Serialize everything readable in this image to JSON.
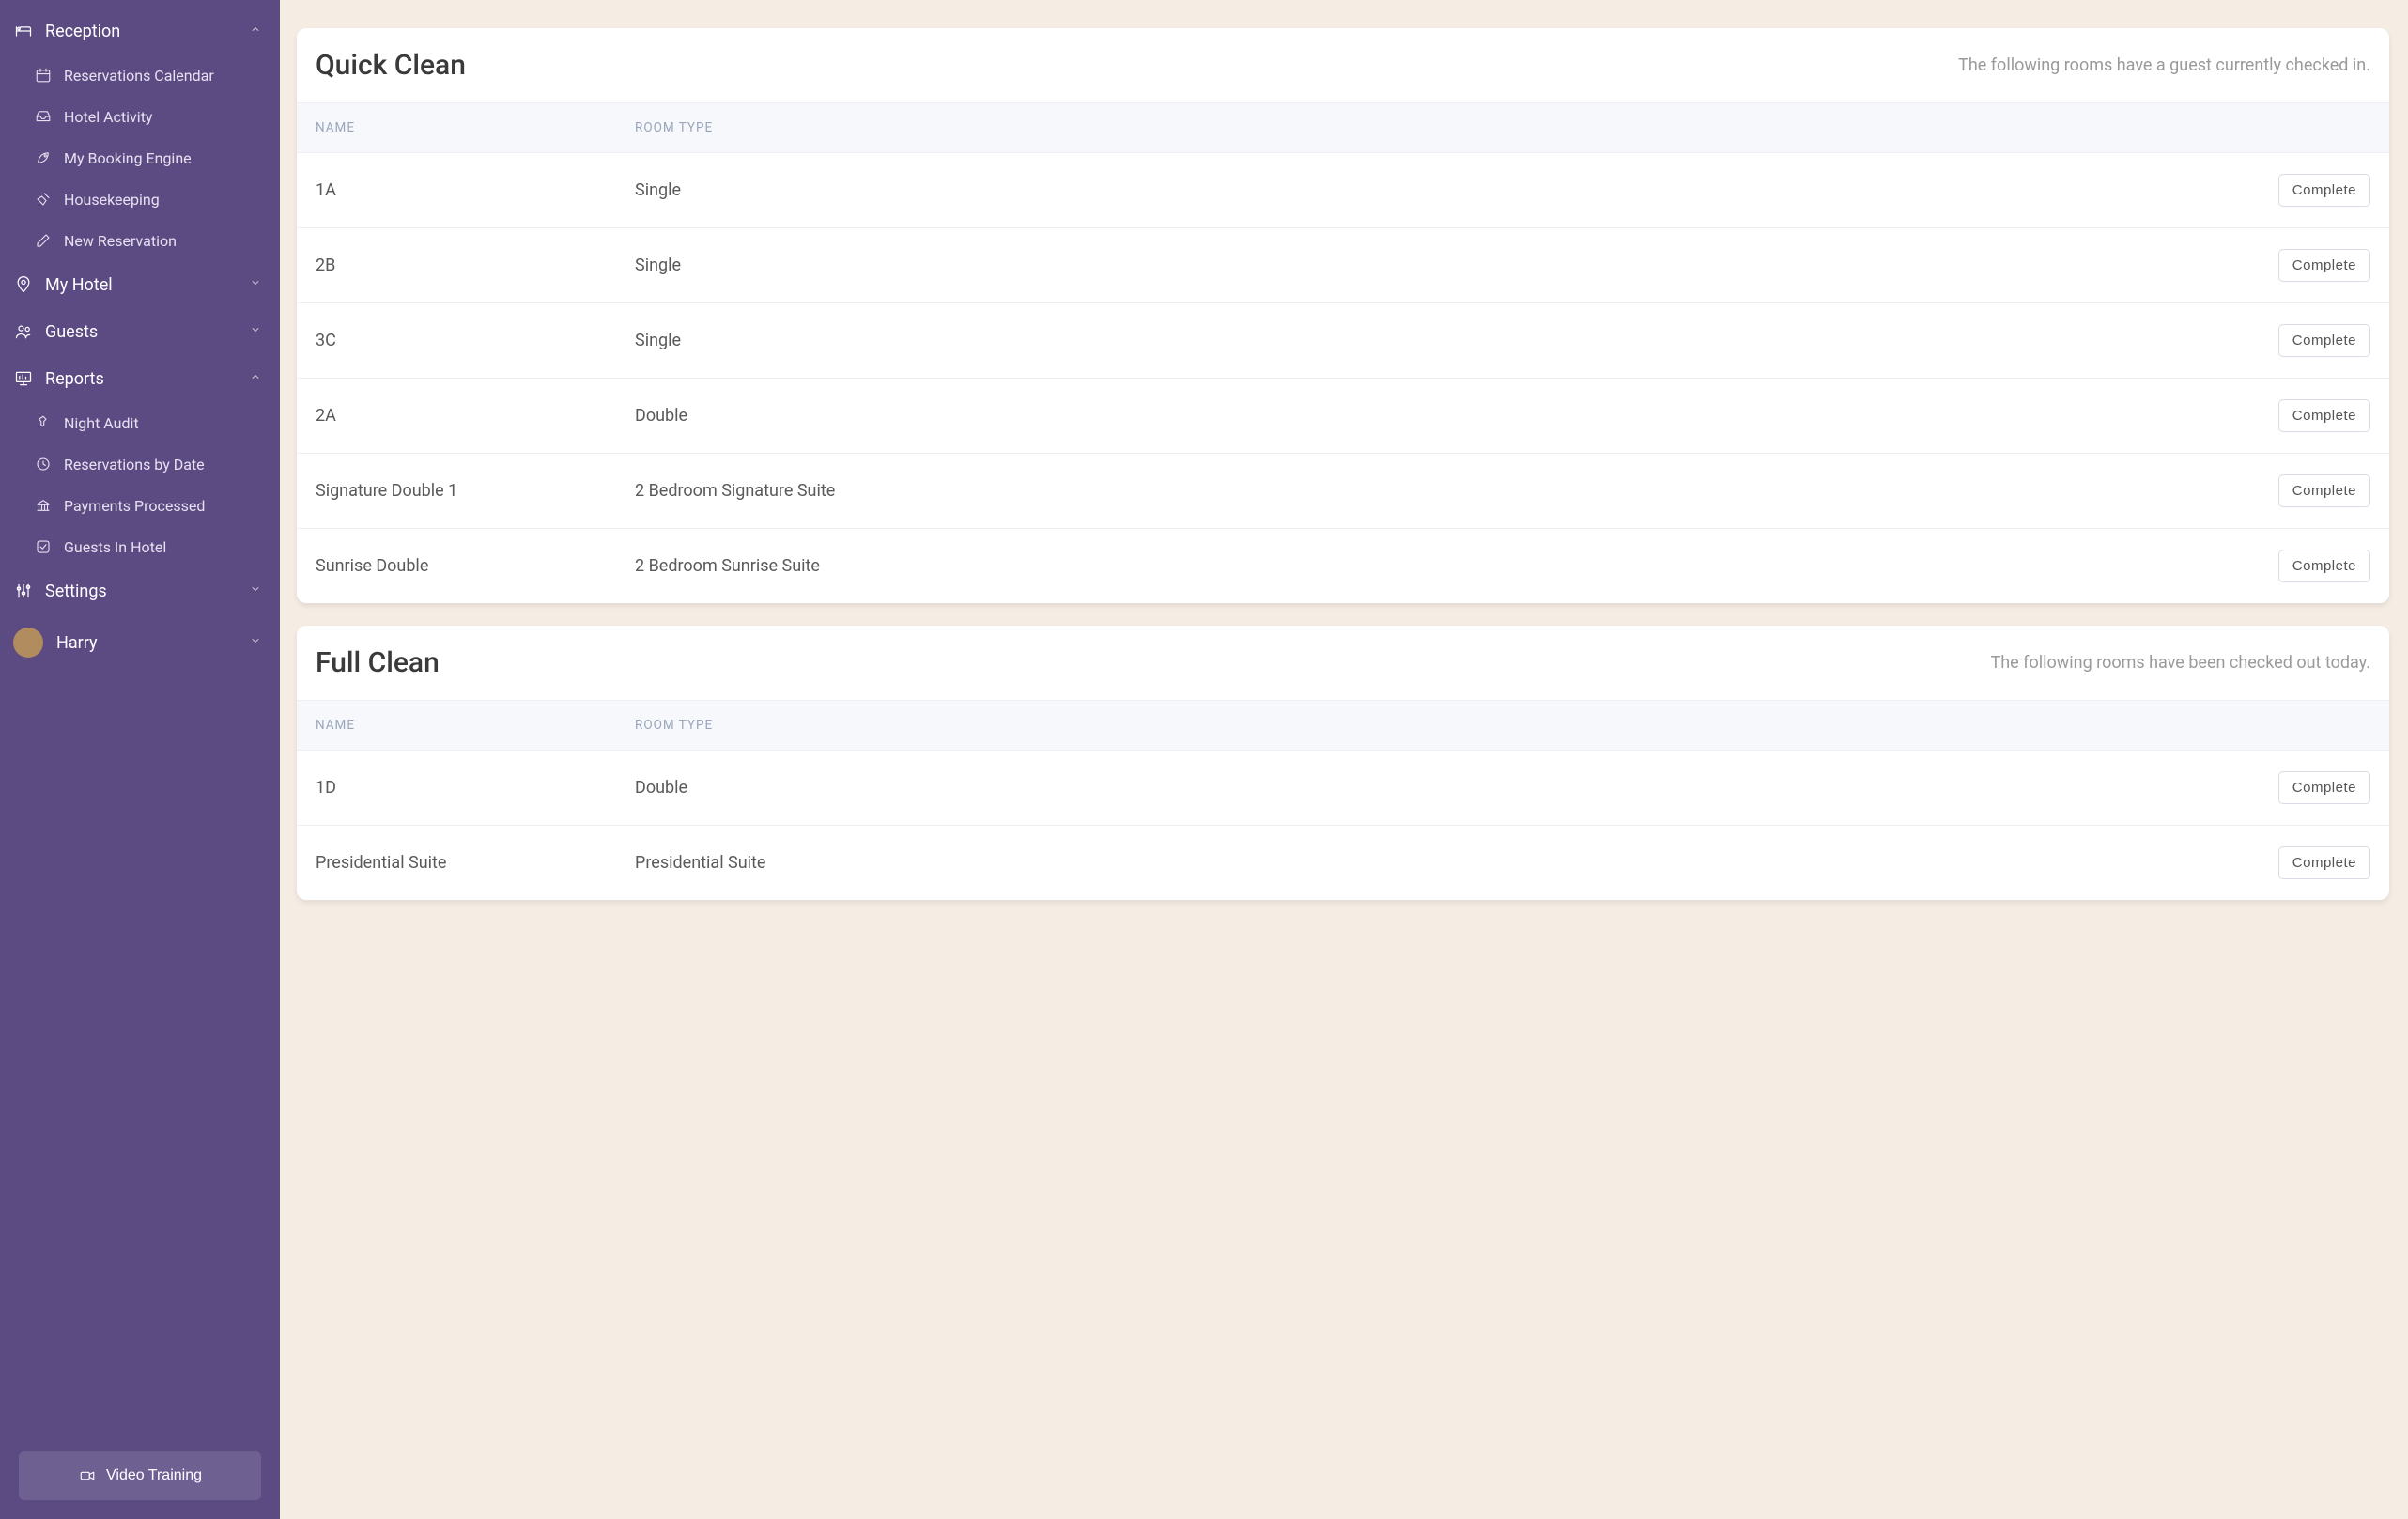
{
  "sidebar": {
    "reception": {
      "label": "Reception",
      "items": [
        {
          "label": "Reservations Calendar"
        },
        {
          "label": "Hotel Activity"
        },
        {
          "label": "My Booking Engine"
        },
        {
          "label": "Housekeeping"
        },
        {
          "label": "New Reservation"
        }
      ]
    },
    "myhotel": {
      "label": "My Hotel"
    },
    "guests": {
      "label": "Guests"
    },
    "reports": {
      "label": "Reports",
      "items": [
        {
          "label": "Night Audit"
        },
        {
          "label": "Reservations by Date"
        },
        {
          "label": "Payments Processed"
        },
        {
          "label": "Guests In Hotel"
        }
      ]
    },
    "settings": {
      "label": "Settings"
    },
    "user": {
      "name": "Harry"
    },
    "video_training": "Video Training"
  },
  "quick_clean": {
    "title": "Quick Clean",
    "subtitle": "The following rooms have a guest currently checked in.",
    "columns": {
      "name": "NAME",
      "type": "ROOM TYPE"
    },
    "button_label": "Complete",
    "rows": [
      {
        "name": "1A",
        "type": "Single"
      },
      {
        "name": "2B",
        "type": "Single"
      },
      {
        "name": "3C",
        "type": "Single"
      },
      {
        "name": "2A",
        "type": "Double"
      },
      {
        "name": "Signature Double 1",
        "type": "2 Bedroom Signature Suite"
      },
      {
        "name": "Sunrise Double",
        "type": "2 Bedroom Sunrise Suite"
      }
    ]
  },
  "full_clean": {
    "title": "Full Clean",
    "subtitle": "The following rooms have been checked out today.",
    "columns": {
      "name": "NAME",
      "type": "ROOM TYPE"
    },
    "button_label": "Complete",
    "rows": [
      {
        "name": "1D",
        "type": "Double"
      },
      {
        "name": "Presidential Suite",
        "type": "Presidential Suite"
      }
    ]
  }
}
